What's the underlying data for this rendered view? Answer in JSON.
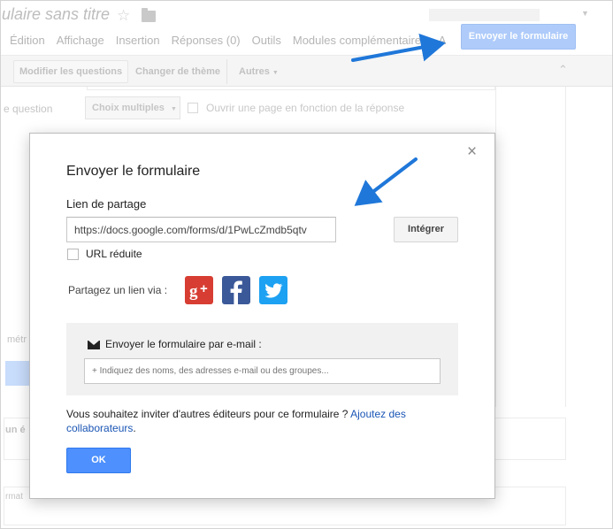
{
  "app": {
    "doc_title": "ulaire sans titre",
    "menu": [
      "Édition",
      "Affichage",
      "Insertion",
      "Réponses (0)",
      "Outils",
      "Modules complémentaires",
      "A"
    ],
    "send_form_label": "Envoyer le formulaire",
    "toolbar": {
      "edit_questions": "Modifier les questions",
      "change_theme": "Changer de thème",
      "more": "Autres"
    },
    "question_label": "e question",
    "question_type": "Choix multiples",
    "page_branch_label": "Ouvrir une page en fonction de la réponse",
    "side_text_1": "métr",
    "side_text_2": "un é",
    "side_text_3": "rmat"
  },
  "dialog": {
    "title": "Envoyer le formulaire",
    "close_glyph": "×",
    "share_label": "Lien de partage",
    "share_url": "https://docs.google.com/forms/d/1PwLcZmdb5qtv",
    "embed_label": "Intégrer",
    "short_url_label": "URL réduite",
    "share_via_label": "Partagez un lien via :",
    "email_label": "Envoyer le formulaire par e-mail :",
    "email_placeholder": "+ Indiquez des noms, des adresses e-mail ou des groupes...",
    "invite_text": "Vous souhaitez inviter d'autres éditeurs pour ce formulaire ?",
    "invite_link": "Ajoutez des collaborateurs",
    "invite_end": ".",
    "ok_label": "OK"
  },
  "colors": {
    "primary_blue": "#4d90fe",
    "annotation_arrow": "#1f77d9",
    "gplus": "#d73d32",
    "facebook": "#3b5998",
    "twitter": "#1da1f2"
  },
  "icons": [
    "star-icon",
    "folder-icon",
    "collapse-icon",
    "close-icon",
    "mail-icon",
    "google-plus-icon",
    "facebook-icon",
    "twitter-icon",
    "annotation-arrow"
  ]
}
